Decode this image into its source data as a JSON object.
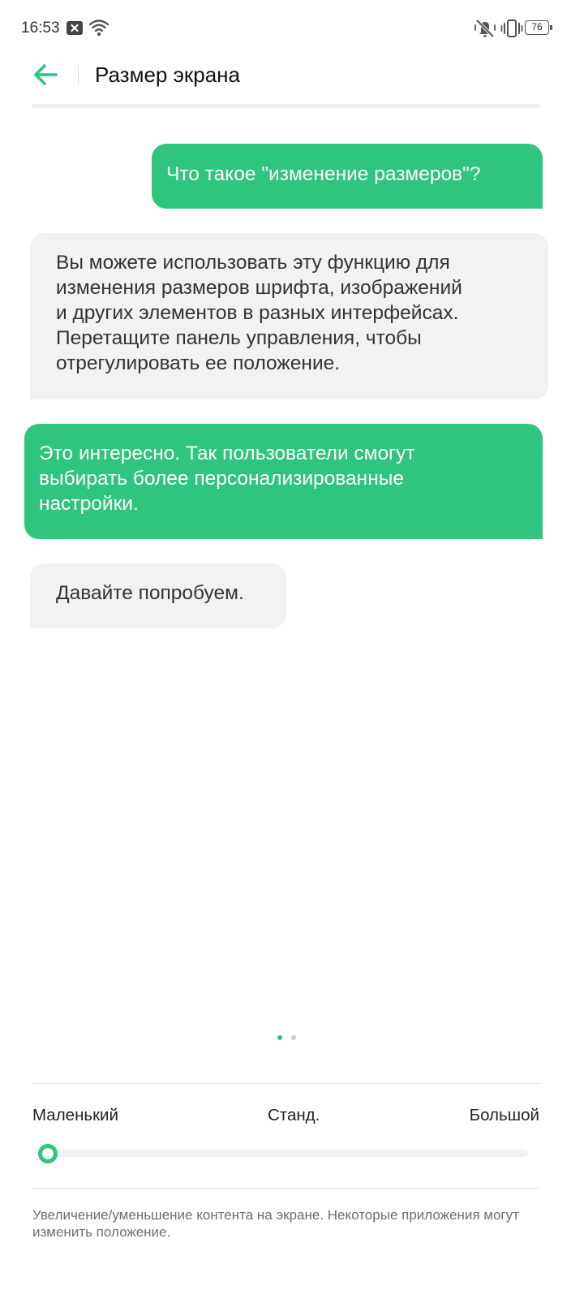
{
  "status_bar": {
    "time": "16:53",
    "battery_level": "76",
    "icons": [
      "notification-x-icon",
      "wifi-icon",
      "mute-icon",
      "vibrate-icon",
      "battery-icon"
    ]
  },
  "header": {
    "title": "Размер экрана",
    "back_icon": "back-arrow-icon"
  },
  "chat": {
    "messages": [
      {
        "side": "right",
        "text": "Что такое \"изменение размеров\"?"
      },
      {
        "side": "left",
        "text": "Вы можете использовать эту функцию для\nизменения размеров шрифта, изображений\nи других элементов в разных интерфейсах.\nПеретащите панель управления, чтобы\nотрегулировать ее положение."
      },
      {
        "side": "right",
        "text": "Это интересно. Так пользователи смогут\nвыбирать более персонализированные\nнастройки."
      },
      {
        "side": "left",
        "text": "Давайте попробуем."
      }
    ]
  },
  "pager": {
    "pages": 2,
    "active_page": 1
  },
  "size_control": {
    "labels": {
      "small": "Маленький",
      "standard": "Станд.",
      "large": "Большой"
    },
    "value_fraction": 0
  },
  "footnote": "Увеличение/уменьшение контента на экране. Некоторые приложения могут изменить положение.",
  "colors": {
    "accent": "#2fc57c",
    "bubble_grey": "#f2f2f2"
  }
}
